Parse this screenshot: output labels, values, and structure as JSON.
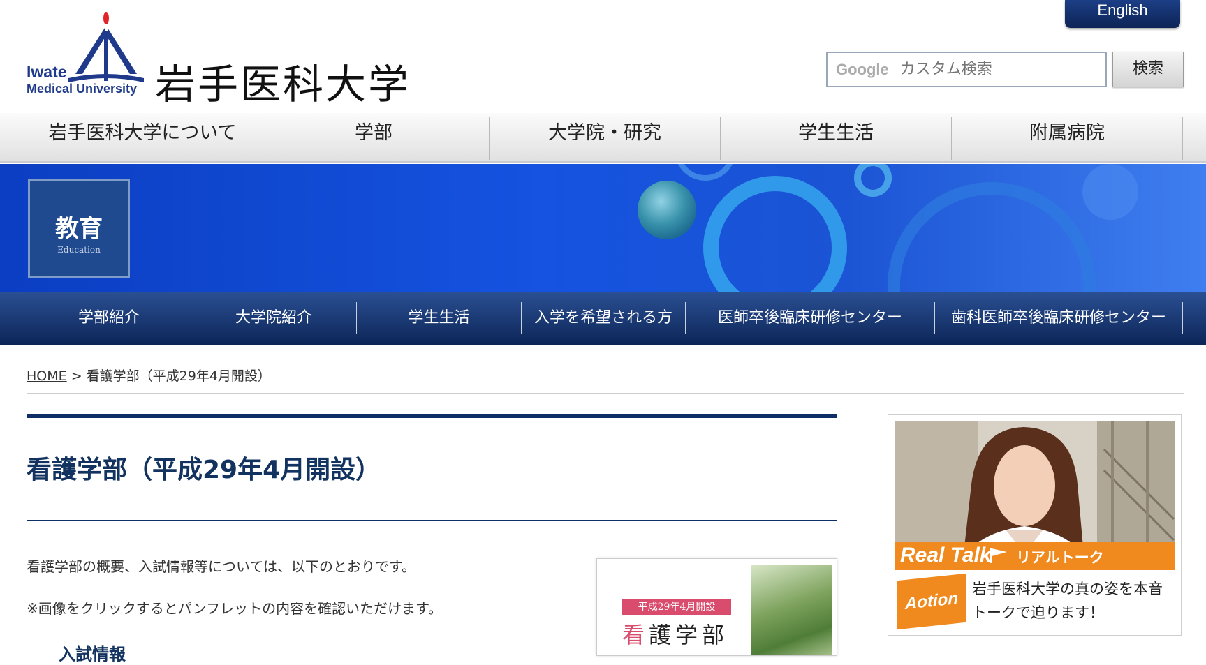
{
  "header": {
    "logo_en_line1": "Iwate",
    "logo_en_line2": "Medical University",
    "logo_jp": "岩手医科大学",
    "english_label": "English",
    "search_placeholder": "カスタム検索",
    "search_brand": "Google",
    "search_button": "検索"
  },
  "main_nav": [
    "岩手医科大学について",
    "学部",
    "大学院・研究",
    "学生生活",
    "附属病院"
  ],
  "banner": {
    "section_jp": "教育",
    "section_en": "Education"
  },
  "sub_nav": [
    "学部紹介",
    "大学院紹介",
    "学生生活",
    "入学を希望される方",
    "医師卒後臨床研修センター",
    "歯科医師卒後臨床研修センター"
  ],
  "breadcrumb": {
    "home": "HOME",
    "separator": ">",
    "current": "看護学部（平成29年4月開設）"
  },
  "content": {
    "title": "看護学部（平成29年4月開設）",
    "intro": "看護学部の概要、入試情報等については、以下のとおりです。",
    "note": "※画像をクリックするとパンフレットの内容を確認いただけます。",
    "section_heading": "入試情報"
  },
  "pamphlet": {
    "pill": "平成29年4月開設",
    "title_first": "看",
    "title_rest": "護学部"
  },
  "side": {
    "realtalk_en": "Real Talk",
    "realtalk_jp": "リアルトーク",
    "action_label": "Aotion",
    "description": "岩手医科大学の真の姿を本音トークで迫ります！"
  },
  "colors": {
    "navy": "#0d2f66",
    "banner_blue": "#1553e0",
    "orange": "#f08a1e",
    "pink": "#d94c6d"
  }
}
